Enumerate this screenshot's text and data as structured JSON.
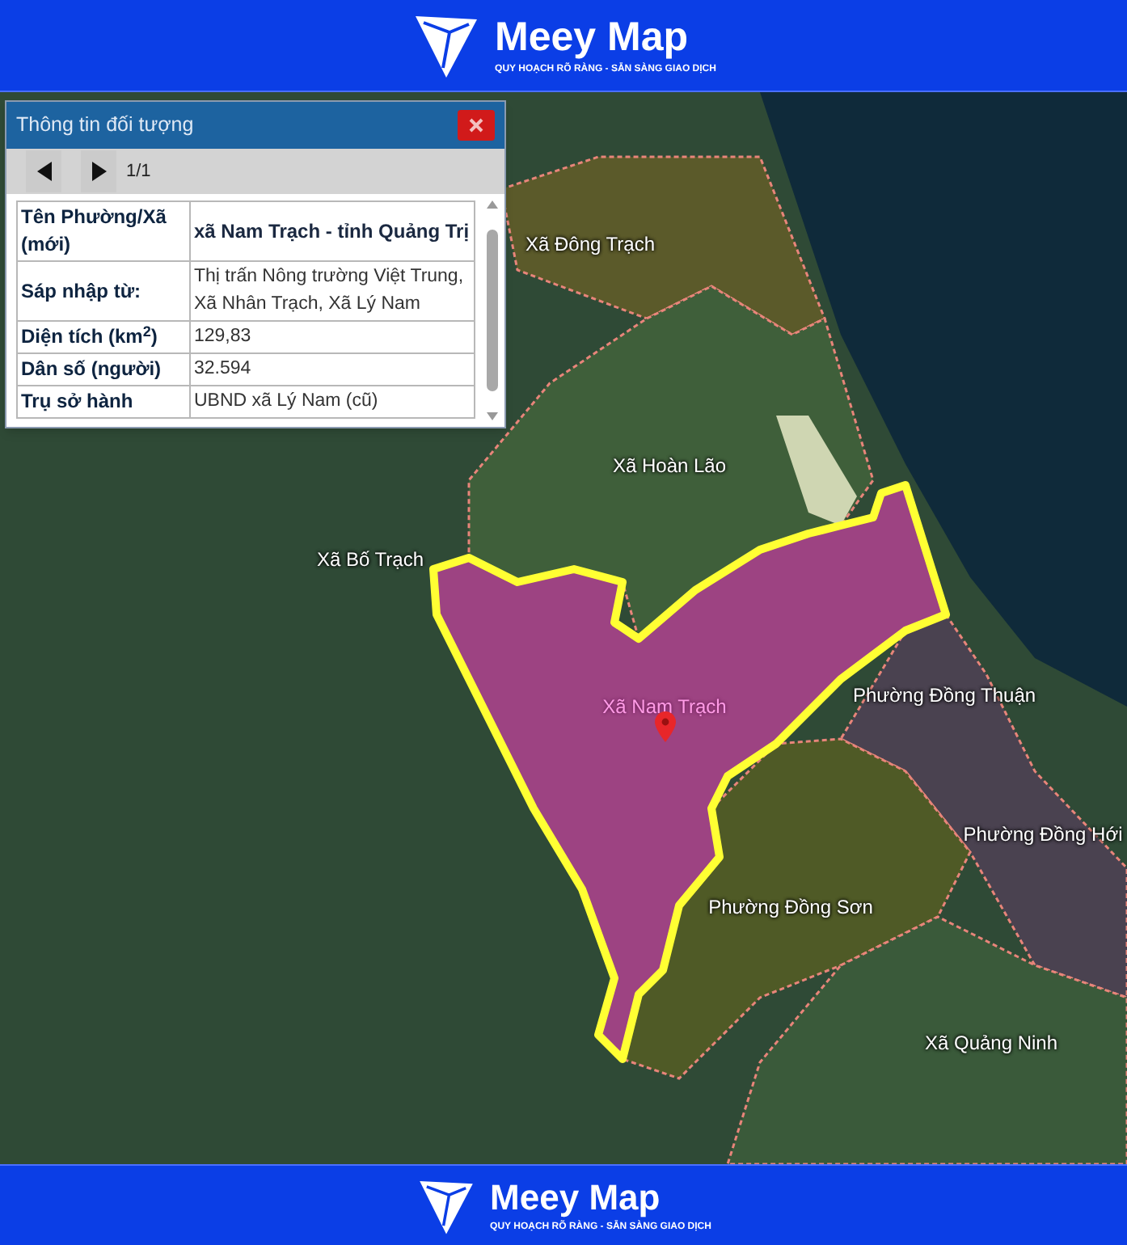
{
  "header": {
    "brand": "Meey Map",
    "tagline": "QUY HOẠCH RÕ RÀNG - SẴN SÀNG GIAO DỊCH"
  },
  "map": {
    "labels": [
      {
        "text": "Xã Đông Trạch",
        "selected": false
      },
      {
        "text": "Xã Hoàn Lão",
        "selected": false
      },
      {
        "text": "Xã Bố Trạch",
        "selected": false
      },
      {
        "text": "Xã Nam Trạch",
        "selected": true
      },
      {
        "text": "Phường Đồng Thuận",
        "selected": false
      },
      {
        "text": "Phường Đồng Hới",
        "selected": false
      },
      {
        "text": "Phường Đồng Sơn",
        "selected": false
      },
      {
        "text": "Xã Quảng Ninh",
        "selected": false
      }
    ]
  },
  "popup": {
    "title": "Thông tin đối tượng",
    "pager": "1/1",
    "rows": [
      {
        "label": "Tên Phường/Xã (mới)",
        "value": "xã Nam Trạch - tỉnh Quảng Trị",
        "bold": true
      },
      {
        "label": "Sáp nhập từ:",
        "value": "Thị trấn Nông trường Việt Trung, Xã Nhân Trạch, Xã Lý Nam",
        "bold": false
      },
      {
        "label": "Diện tích (km$^{2}$)",
        "value": "129,83",
        "bold": false
      },
      {
        "label": "Dân số (người)",
        "value": "32.594",
        "bold": false
      },
      {
        "label": "Trụ sở hành",
        "value": "UBND xã Lý Nam (cũ)",
        "bold": false
      }
    ]
  },
  "footer": {
    "brand": "Meey Map",
    "tagline": "QUY HOẠCH RÕ RÀNG - SẴN SÀNG GIAO DỊCH"
  }
}
